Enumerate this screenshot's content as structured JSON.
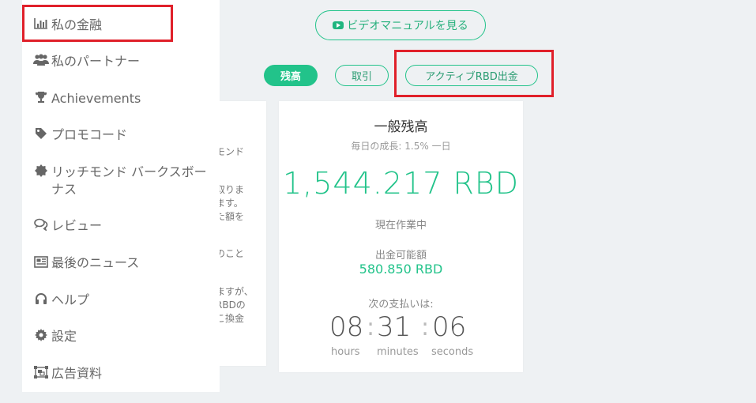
{
  "header": {
    "video_button": "ビデオマニュアルを見る"
  },
  "tabs": [
    {
      "label": "残高"
    },
    {
      "label": "取引"
    },
    {
      "label": "アクティブRBD出金"
    }
  ],
  "sidebar": {
    "items": [
      {
        "label": "私の金融",
        "icon": "bar-chart-icon"
      },
      {
        "label": "私のパートナー",
        "icon": "users-icon"
      },
      {
        "label": "Achievements",
        "icon": "trophy-icon"
      },
      {
        "label": "プロモコード",
        "icon": "tag-icon"
      },
      {
        "label": "リッチモンド バークスボーナス",
        "icon": "certificate-icon"
      },
      {
        "label": "レビュー",
        "icon": "comments-icon"
      },
      {
        "label": "最後のニュース",
        "icon": "newspaper-icon"
      },
      {
        "label": "ヘルプ",
        "icon": "headphones-icon"
      },
      {
        "label": "設定",
        "icon": "gear-icon"
      },
      {
        "label": "広告資料",
        "icon": "object-group-icon"
      }
    ]
  },
  "left_card": {
    "fragments": [
      "モンド",
      "取りま",
      "ます。",
      "た額を",
      "のこと",
      "ますが、",
      "RBDの",
      "こ換金"
    ]
  },
  "balance_card": {
    "title": "一般残高",
    "growth": "毎日の成長: 1.5% 一日",
    "amount": "1,544.217 RBD",
    "status": "現在作業中",
    "withdrawable_label": "出金可能額",
    "withdrawable_amount": "580.850 RBD",
    "next_payment_label": "次の支払いは:",
    "timer": {
      "hours": "08",
      "minutes": "31",
      "seconds": "06",
      "hours_label": "hours",
      "minutes_label": "minutes",
      "seconds_label": "seconds"
    }
  },
  "colors": {
    "accent": "#22c38a",
    "highlight": "#e0202a",
    "background": "#eef1f3"
  }
}
